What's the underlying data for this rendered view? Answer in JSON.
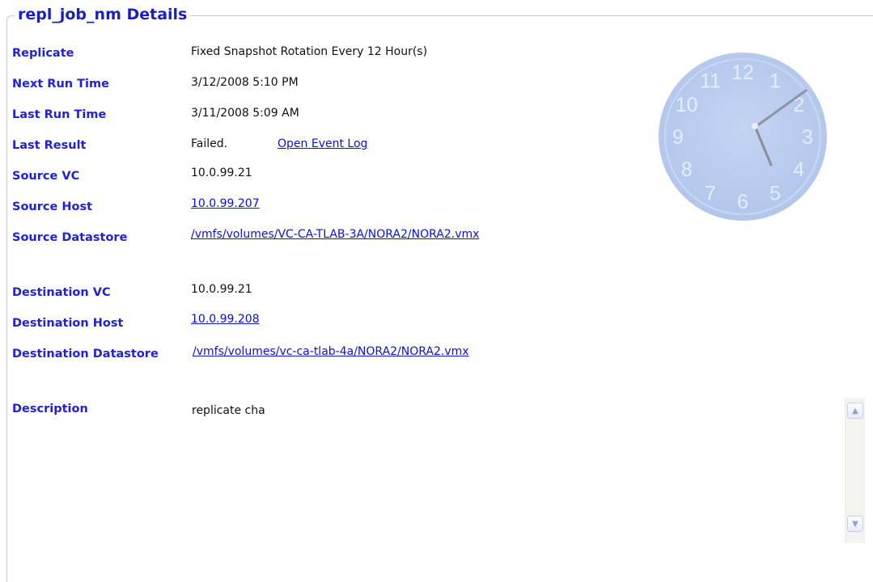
{
  "header": {
    "title": "repl_job_nm Details"
  },
  "details": {
    "replicate": {
      "label": "Replicate",
      "value": "Fixed Snapshot Rotation Every 12 Hour(s)"
    },
    "next_run": {
      "label": "Next Run Time",
      "value": "3/12/2008 5:10 PM"
    },
    "last_run": {
      "label": "Last Run Time",
      "value": "3/11/2008 5:09 AM"
    },
    "last_result": {
      "label": "Last Result",
      "value": "Failed.",
      "link": "Open Event Log"
    },
    "source_vc": {
      "label": "Source VC",
      "value": "10.0.99.21"
    },
    "source_host": {
      "label": "Source Host",
      "value": "10.0.99.207"
    },
    "source_datastore": {
      "label": "Source Datastore",
      "value": "/vmfs/volumes/VC-CA-TLAB-3A/NORA2/NORA2.vmx"
    },
    "dest_vc": {
      "label": "Destination VC",
      "value": "10.0.99.21"
    },
    "dest_host": {
      "label": "Destination Host",
      "value": "10.0.99.208"
    },
    "dest_datastore": {
      "label": "Destination Datastore",
      "value": "/vmfs/volumes/vc-ca-tlab-4a/NORA2/NORA2.vmx"
    },
    "description": {
      "label": "Description",
      "value": "replicate cha"
    }
  },
  "clock": {
    "numbers": [
      "12",
      "1",
      "2",
      "3",
      "4",
      "5",
      "6",
      "7",
      "8",
      "9",
      "10",
      "11"
    ],
    "face_color": "#b9cbee",
    "icon": "clock-icon"
  },
  "colors": {
    "label": "#2121d6",
    "link": "#0b12d0",
    "title": "#1a1fc4"
  }
}
